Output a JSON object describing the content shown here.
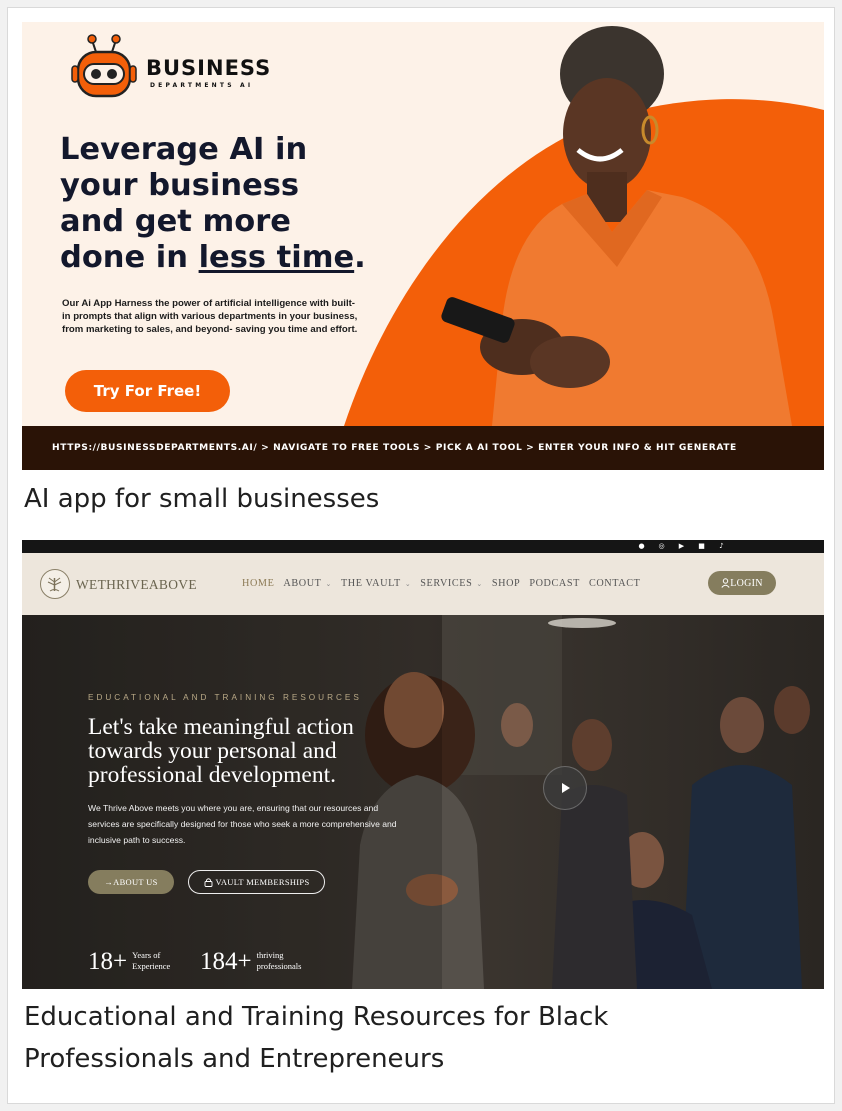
{
  "card1": {
    "brand": "BUSINESS",
    "brand_sub": "DEPARTMENTS AI",
    "headline": [
      "Leverage AI in",
      "your business",
      "and get more",
      "done in "
    ],
    "headline_underlined": "less time",
    "headline_end": ".",
    "body": "Our Ai App Harness the power of artificial intelligence with built-in prompts that align with various departments in your business, from marketing to sales, and beyond- saving you time and effort.",
    "cta": "Try For Free!",
    "strip": "HTTPS://BUSINESSDEPARTMENTS.AI/ > NAVIGATE TO FREE TOOLS > PICK A AI TOOL > ENTER YOUR INFO & HIT GENERATE",
    "colors": {
      "accent": "#f35f09",
      "navy": "#13182c",
      "strip": "#2a1306",
      "background": "#fdf2e8"
    }
  },
  "caption1": "AI app for small businesses",
  "card2": {
    "social_icons": [
      "facebook-icon",
      "instagram-icon",
      "youtube-icon",
      "linkedin-icon",
      "tiktok-icon"
    ],
    "logo_text": "WETHRIVEABOVE",
    "nav": [
      {
        "label": "HOME",
        "dropdown": false,
        "active": true
      },
      {
        "label": "ABOUT",
        "dropdown": true,
        "active": false
      },
      {
        "label": "THE VAULT",
        "dropdown": true,
        "active": false
      },
      {
        "label": "SERVICES",
        "dropdown": true,
        "active": false
      },
      {
        "label": "SHOP",
        "dropdown": false,
        "active": false
      },
      {
        "label": "PODCAST",
        "dropdown": false,
        "active": false
      },
      {
        "label": "CONTACT",
        "dropdown": false,
        "active": false
      }
    ],
    "login": "LOGIN",
    "overtitle": "EDUCATIONAL AND TRAINING RESOURCES",
    "title": "Let's take meaningful action towards your personal and professional development.",
    "description": "We Thrive Above meets you where you are, ensuring that our resources and services are specifically designed for those who seek a more comprehensive and inclusive path to success.",
    "btn_about": "→ABOUT US",
    "btn_vault": "VAULT MEMBERSHIPS",
    "stats": [
      {
        "number": "18+",
        "label_1": "Years of",
        "label_2": "Experience"
      },
      {
        "number": "184+",
        "label_1": "thriving",
        "label_2": "professionals"
      }
    ],
    "colors": {
      "olive": "#857d5e",
      "nav_bg": "#ede6dc"
    }
  },
  "caption2": "Educational and Training Resources for Black Professionals and Entrepreneurs"
}
